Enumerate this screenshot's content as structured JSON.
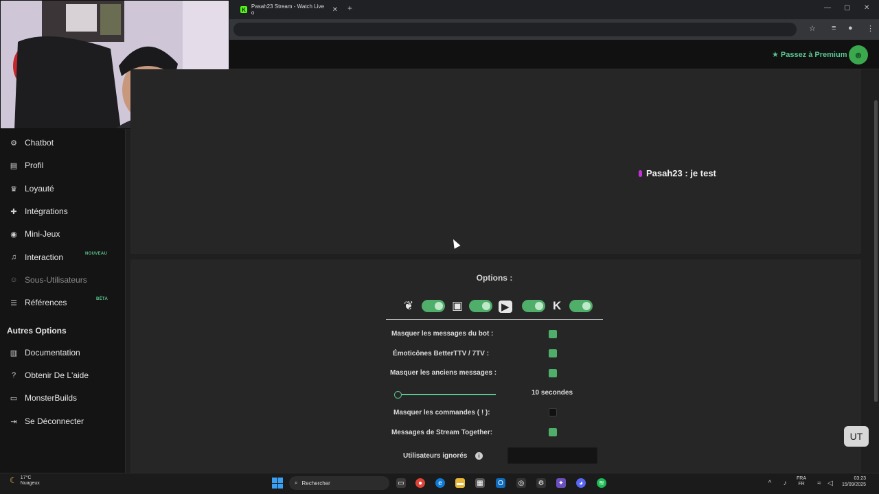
{
  "browser": {
    "tab_title": "Pasah23 Stream - Watch Live o",
    "tab_favicon": "K",
    "tab_close": "✕",
    "new_tab": "+"
  },
  "header": {
    "premium_label": "Passez à Premium",
    "premium_icon": "star-icon"
  },
  "sidebar": {
    "items": [
      {
        "label": "Chatbot",
        "icon": "robot-icon"
      },
      {
        "label": "Profil",
        "icon": "id-card-icon"
      },
      {
        "label": "Loyauté",
        "icon": "trophy-icon"
      },
      {
        "label": "Intégrations",
        "icon": "puzzle-icon"
      },
      {
        "label": "Mini-Jeux",
        "icon": "gamepad-icon"
      },
      {
        "label": "Interaction",
        "icon": "music-icon",
        "tag": "NOUVEAU"
      },
      {
        "label": "Sous-Utilisateurs",
        "icon": "users-icon",
        "disabled": true
      },
      {
        "label": "Références",
        "icon": "user-card-icon",
        "tag": "BÊTA"
      }
    ],
    "section_title": "Autres Options",
    "other_items": [
      {
        "label": "Documentation",
        "icon": "book-icon"
      },
      {
        "label": "Obtenir De L'aide",
        "icon": "help-icon"
      },
      {
        "label": "MonsterBuilds",
        "icon": "laptop-icon"
      },
      {
        "label": "Se Déconnecter",
        "icon": "logout-icon"
      }
    ]
  },
  "preview": {
    "chat_user": "Pasah23",
    "chat_message": " : je test"
  },
  "options": {
    "title": "Options :",
    "platforms": [
      "kick-icon",
      "twitch-icon",
      "youtube-icon",
      "kick-k-icon"
    ],
    "rows": [
      {
        "label": "Masquer les messages du bot :",
        "checked": true
      },
      {
        "label": "Émoticônes BetterTTV / 7TV :",
        "checked": true
      },
      {
        "label": "Masquer les anciens messages :",
        "checked": true
      },
      {
        "label": "Masquer les commandes ( ! ):",
        "checked": false
      },
      {
        "label": "Messages de Stream Together:",
        "checked": true
      }
    ],
    "slider_value": "10 secondes",
    "slider_fraction": 0.0,
    "ignored_label": "Utilisateurs ignorés",
    "info_glyph": "i"
  },
  "badge_text": "UT",
  "taskbar": {
    "weather_temp": "17°C",
    "weather_desc": "Nuageux",
    "search_placeholder": "Rechercher",
    "lang_top": "FRA",
    "lang_bottom": "FR",
    "time": "03:23",
    "date": "15/09/2025"
  },
  "colors": {
    "accent": "#4fae6a",
    "premium": "#5ac58f",
    "chat_badge": "#c330d9"
  }
}
